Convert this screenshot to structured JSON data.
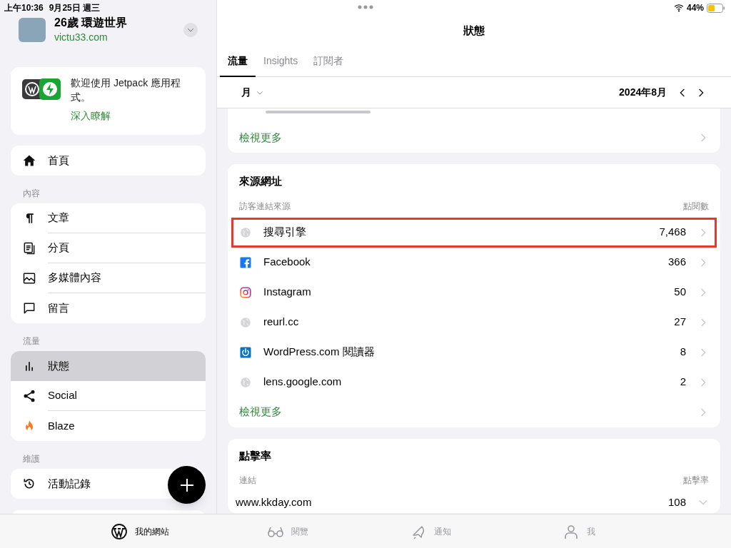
{
  "status_bar": {
    "time": "上午10:36",
    "date": "9月25日 週三",
    "battery": "44%"
  },
  "site": {
    "name": "26歲 環遊世界",
    "url": "victu33.com"
  },
  "promo": {
    "text": "歡迎使用 Jetpack 應用程式。",
    "link": "深入瞭解"
  },
  "menu_groups": [
    {
      "items": [
        {
          "label": "首頁",
          "kind": "home",
          "selected": false
        }
      ]
    },
    {
      "title": "內容",
      "items": [
        {
          "label": "文章",
          "kind": "paragraph",
          "selected": false
        },
        {
          "label": "分頁",
          "kind": "pages",
          "selected": false
        },
        {
          "label": "多媒體內容",
          "kind": "media",
          "selected": false
        },
        {
          "label": "留言",
          "kind": "comment",
          "selected": false
        }
      ]
    },
    {
      "title": "流量",
      "items": [
        {
          "label": "狀態",
          "kind": "stats",
          "selected": true
        },
        {
          "label": "Social",
          "kind": "share",
          "selected": false
        },
        {
          "label": "Blaze",
          "kind": "flame",
          "selected": false
        }
      ]
    },
    {
      "title": "維護",
      "items": [
        {
          "label": "活動記錄",
          "kind": "history",
          "selected": false
        }
      ]
    }
  ],
  "page_title": "狀態",
  "tabs": [
    {
      "label": "流量",
      "selected": true
    },
    {
      "label": "Insights",
      "selected": false
    },
    {
      "label": "訂閱者",
      "selected": false
    }
  ],
  "period": {
    "unit": "月",
    "range": "2024年8月"
  },
  "top_card": {
    "link": "檢視更多"
  },
  "referrers": {
    "title": "來源網址",
    "column_1": "訪客連結來源",
    "column_2": "點閱數",
    "rows": [
      {
        "name": "搜尋引擎",
        "value": "7,468",
        "kind": "globe",
        "highlighted": true
      },
      {
        "name": "Facebook",
        "value": "366",
        "kind": "facebook",
        "highlighted": false
      },
      {
        "name": "Instagram",
        "value": "50",
        "kind": "instagram",
        "highlighted": false
      },
      {
        "name": "reurl.cc",
        "value": "27",
        "kind": "globe",
        "highlighted": false
      },
      {
        "name": "WordPress.com 閱讀器",
        "value": "8",
        "kind": "reader",
        "highlighted": false
      },
      {
        "name": "lens.google.com",
        "value": "2",
        "kind": "globe",
        "highlighted": false
      }
    ],
    "link": "檢視更多"
  },
  "clicks": {
    "title": "點擊率",
    "column_1": "連結",
    "column_2": "點擊率",
    "rows": [
      {
        "name": "www.kkday.com",
        "value": "108"
      }
    ]
  },
  "bottom_tabs": [
    {
      "label": "我的網站",
      "kind": "wordpress",
      "selected": true
    },
    {
      "label": "閱覽",
      "kind": "glasses",
      "selected": false
    },
    {
      "label": "通知",
      "kind": "bell",
      "selected": false
    },
    {
      "label": "我",
      "kind": "person",
      "selected": false
    }
  ]
}
